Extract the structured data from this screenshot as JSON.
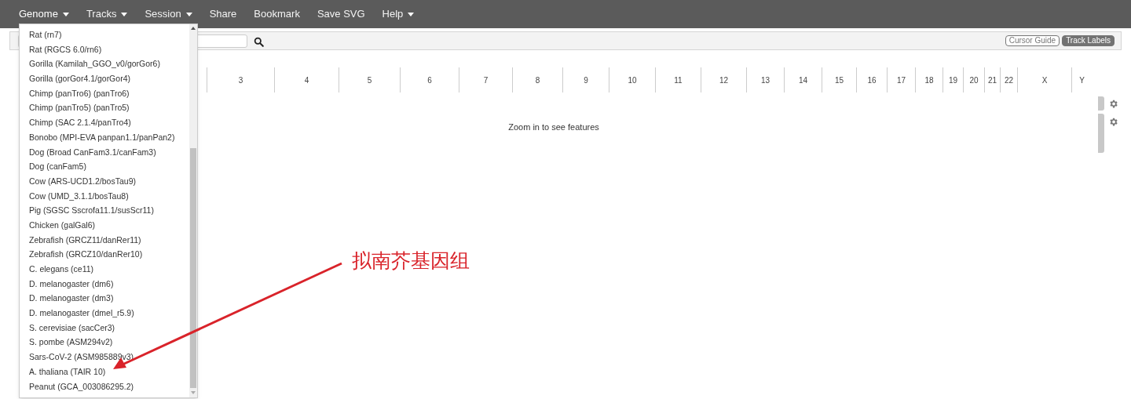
{
  "navbar": {
    "menus": [
      {
        "label": "Genome",
        "dropdown": true,
        "expanded": true
      },
      {
        "label": "Tracks",
        "dropdown": true,
        "expanded": false
      },
      {
        "label": "Session",
        "dropdown": true,
        "expanded": false
      },
      {
        "label": "Share",
        "dropdown": false,
        "expanded": false
      },
      {
        "label": "Bookmark",
        "dropdown": false,
        "expanded": false
      },
      {
        "label": "Save SVG",
        "dropdown": false,
        "expanded": false
      },
      {
        "label": "Help",
        "dropdown": true,
        "expanded": false
      }
    ]
  },
  "toolbar": {
    "toggles": [
      {
        "label": "Cursor Guide",
        "selected": false
      },
      {
        "label": "Track Labels",
        "selected": true
      }
    ]
  },
  "ideogram": {
    "chromosomes": [
      "3",
      "4",
      "5",
      "6",
      "7",
      "8",
      "9",
      "10",
      "11",
      "12",
      "13",
      "14",
      "15",
      "16",
      "17",
      "18",
      "19",
      "20",
      "21",
      "22",
      "X",
      "Y"
    ]
  },
  "message": "Zoom in to see features",
  "genome_menu": {
    "items": [
      "Rat (rn7)",
      "Rat (RGCS 6.0/rn6)",
      "Gorilla (Kamilah_GGO_v0/gorGor6)",
      "Gorilla (gorGor4.1/gorGor4)",
      "Chimp (panTro6) (panTro6)",
      "Chimp (panTro5) (panTro5)",
      "Chimp (SAC 2.1.4/panTro4)",
      "Bonobo (MPI-EVA panpan1.1/panPan2)",
      "Dog (Broad CanFam3.1/canFam3)",
      "Dog (canFam5)",
      "Cow (ARS-UCD1.2/bosTau9)",
      "Cow (UMD_3.1.1/bosTau8)",
      "Pig (SGSC Sscrofa11.1/susScr11)",
      "Chicken (galGal6)",
      "Zebrafish (GRCZ11/danRer11)",
      "Zebrafish (GRCZ10/danRer10)",
      "C. elegans (ce11)",
      "D. melanogaster (dm6)",
      "D. melanogaster (dm3)",
      "D. melanogaster (dmel_r5.9)",
      "S. cerevisiae (sacCer3)",
      "S. pombe (ASM294v2)",
      "Sars-CoV-2 (ASM985889v3)",
      "A. thaliana (TAIR 10)",
      "Peanut (GCA_003086295.2)"
    ]
  },
  "annotation": {
    "text": "拟南芥基因组"
  }
}
